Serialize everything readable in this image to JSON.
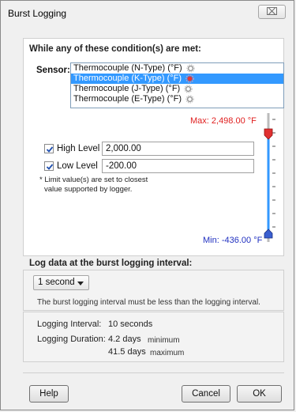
{
  "window": {
    "title": "Burst Logging",
    "close_glyph": "⌧"
  },
  "conditions": {
    "header": "While any of these condition(s) are met:",
    "sensor_label": "Sensor:",
    "sensors": [
      {
        "label": "Thermocouple (N-Type) (°F)",
        "selected": false,
        "icon": "gear-icon"
      },
      {
        "label": "Thermocouple (K-Type) (°F)",
        "selected": true,
        "icon": "alarm-gear-icon"
      },
      {
        "label": "Thermocouple (J-Type) (°F)",
        "selected": false,
        "icon": "gear-icon"
      },
      {
        "label": "Thermocouple (E-Type) (°F)",
        "selected": false,
        "icon": "gear-icon"
      }
    ],
    "max_label": "Max: 2,498.00 °F",
    "min_label": "Min: -436.00 °F",
    "high_level": {
      "label": "High Level",
      "checked": true,
      "value": "2,000.00"
    },
    "low_level": {
      "label": "Low Level",
      "checked": true,
      "value": "-200.00"
    },
    "note_line1": "* Limit value(s) are set to closest",
    "note_line2": "value supported by logger.",
    "colors": {
      "max": "#e02020",
      "min": "#2030c0",
      "high_marker": "#e03030",
      "low_marker": "#3a5fd0"
    }
  },
  "interval": {
    "header": "Log data at the burst logging interval:",
    "selected": "1 second",
    "help": "The burst logging interval must be less than the logging interval.",
    "logging_interval_label": "Logging Interval:",
    "logging_interval_value": "10 seconds",
    "logging_duration_label": "Logging Duration:",
    "min_duration_value": "4.2 days",
    "min_duration_suffix": "minimum",
    "max_duration_value": "41.5 days",
    "max_duration_suffix": "maximum"
  },
  "buttons": {
    "help": "Help",
    "cancel": "Cancel",
    "ok": "OK"
  }
}
